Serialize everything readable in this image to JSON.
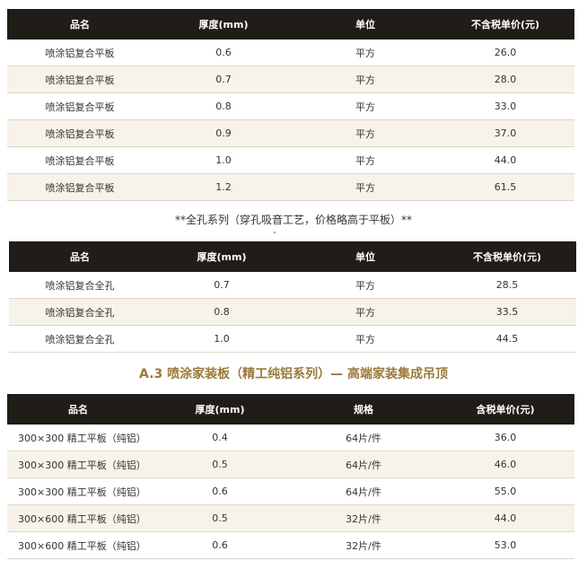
{
  "table1": {
    "headers": [
      "品名",
      "厚度(mm)",
      "单位",
      "不含税单价(元)"
    ],
    "rows": [
      [
        "喷涂铝复合平板",
        "0.6",
        "平方",
        "26.0"
      ],
      [
        "喷涂铝复合平板",
        "0.7",
        "平方",
        "28.0"
      ],
      [
        "喷涂铝复合平板",
        "0.8",
        "平方",
        "33.0"
      ],
      [
        "喷涂铝复合平板",
        "0.9",
        "平方",
        "37.0"
      ],
      [
        "喷涂铝复合平板",
        "1.0",
        "平方",
        "44.0"
      ],
      [
        "喷涂铝复合平板",
        "1.2",
        "平方",
        "61.5"
      ]
    ]
  },
  "note": "**全孔系列（穿孔吸音工艺，价格略高于平板）**",
  "table2": {
    "headers": [
      "品名",
      "厚度(mm)",
      "单位",
      "不含税单价(元)"
    ],
    "rows": [
      [
        "喷涂铝复合全孔",
        "0.7",
        "平方",
        "28.5"
      ],
      [
        "喷涂铝复合全孔",
        "0.8",
        "平方",
        "33.5"
      ],
      [
        "喷涂铝复合全孔",
        "1.0",
        "平方",
        "44.5"
      ]
    ]
  },
  "section_title": "A.3 喷涂家装板（精工纯铝系列）— 高端家装集成吊顶",
  "table3": {
    "headers": [
      "品名",
      "厚度(mm)",
      "规格",
      "含税单价(元)"
    ],
    "rows": [
      [
        "300×300 精工平板（纯铝）",
        "0.4",
        "64片/件",
        "36.0"
      ],
      [
        "300×300 精工平板（纯铝）",
        "0.5",
        "64片/件",
        "46.0"
      ],
      [
        "300×300 精工平板（纯铝）",
        "0.6",
        "64片/件",
        "55.0"
      ],
      [
        "300×600 精工平板（纯铝）",
        "0.5",
        "32片/件",
        "44.0"
      ],
      [
        "300×600 精工平板（纯铝）",
        "0.6",
        "32片/件",
        "53.0"
      ]
    ]
  },
  "colors": {
    "header_bg": "#201c18",
    "stripe_bg": "#f7f3ea",
    "accent": "#9a7a3a"
  }
}
